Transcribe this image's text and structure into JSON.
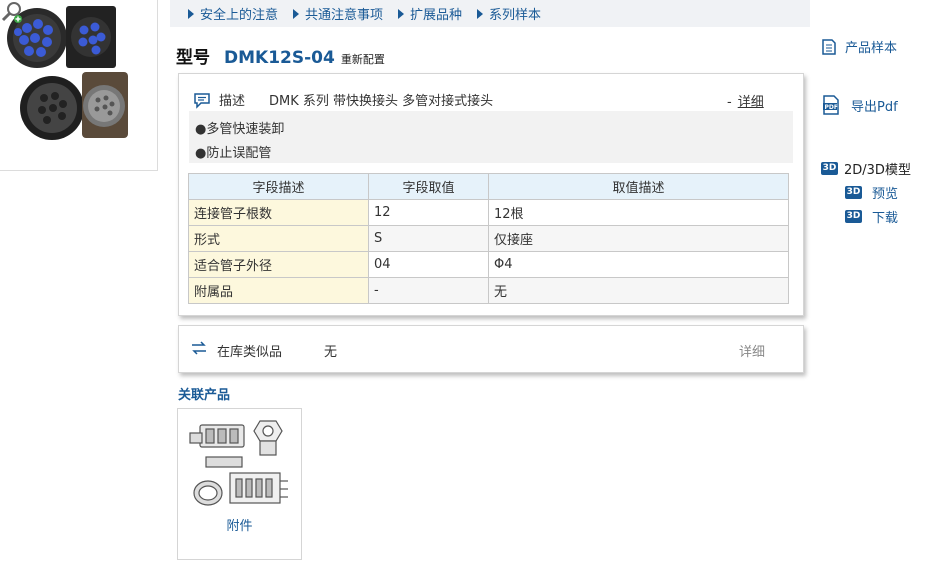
{
  "breadcrumbs": [
    "安全上的注意",
    "共通注意事项",
    "扩展品种",
    "系列样本"
  ],
  "model": {
    "label": "型号",
    "code": "DMK12S-04",
    "reconfigure": "重新配置"
  },
  "description": {
    "label": "描述",
    "text": "DMK 系列 带快换接头 多管对接式接头",
    "detail_prefix": "-",
    "detail_link": "详细",
    "features": [
      "●多管快速装卸",
      "●防止误配管"
    ]
  },
  "spec_table": {
    "headers": [
      "字段描述",
      "字段取值",
      "取值描述"
    ],
    "rows": [
      [
        "连接管子根数",
        "12",
        "12根"
      ],
      [
        "形式",
        "S",
        "仅接座"
      ],
      [
        "适合管子外径",
        "04",
        "Φ4"
      ],
      [
        "附属品",
        "-",
        "无"
      ]
    ]
  },
  "stock": {
    "label": "在库类似品",
    "value": "无",
    "detail": "详细"
  },
  "related": {
    "title": "关联产品",
    "items": [
      {
        "label": "附件"
      }
    ]
  },
  "sidebar": {
    "catalog": "产品样本",
    "export_pdf": "导出Pdf",
    "model_2d3d": "2D/3D模型",
    "preview": "预览",
    "download": "下载",
    "badge": "3D"
  },
  "colors": {
    "link": "#1a5a96",
    "table_header": "#e6f2fa",
    "table_first_col": "#fdf8dd"
  },
  "icons": [
    "magnifier-plus-icon",
    "speech-bubble-icon",
    "swap-arrows-icon",
    "catalog-book-icon",
    "pdf-icon",
    "3d-badge-icon"
  ]
}
